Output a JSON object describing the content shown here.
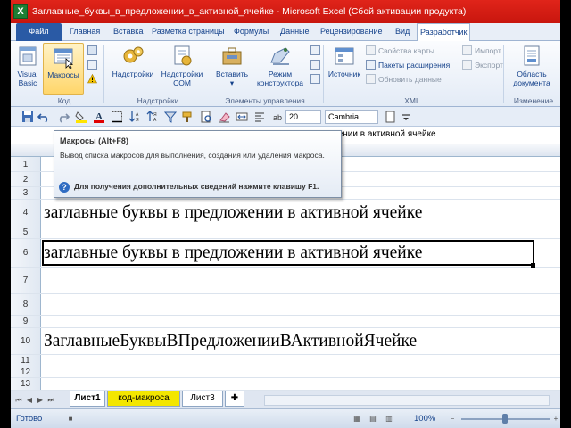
{
  "window": {
    "title": "Заглавные_буквы_в_предложении_в_активной_ячейке - Microsoft Excel (Сбой активации продукта)",
    "app_icon_letter": "X"
  },
  "tabs": [
    {
      "label": "Файл"
    },
    {
      "label": "Главная"
    },
    {
      "label": "Вставка"
    },
    {
      "label": "Разметка страницы"
    },
    {
      "label": "Формулы"
    },
    {
      "label": "Данные"
    },
    {
      "label": "Рецензирование"
    },
    {
      "label": "Вид"
    },
    {
      "label": "Разработчик"
    }
  ],
  "ribbon": {
    "code_group": {
      "label": "Код",
      "visual_basic_line1": "Visual",
      "visual_basic_line2": "Basic",
      "macros": "Макросы"
    },
    "addins_group": {
      "label": "Надстройки",
      "addins": "Надстройки",
      "com_addins_line1": "Надстройки",
      "com_addins_line2": "COM"
    },
    "controls_group": {
      "label": "Элементы управления",
      "insert": "Вставить",
      "design_mode_line1": "Режим",
      "design_mode_line2": "конструктора"
    },
    "xml_group": {
      "label": "XML",
      "source": "Источник",
      "map_properties": "Свойства карты",
      "expansion_packs": "Пакеты расширения",
      "refresh_data": "Обновить данные",
      "import": "Импорт",
      "export": "Экспорт"
    },
    "modify_group": {
      "label": "Изменение",
      "document_panel_line1": "Область",
      "document_panel_line2": "документа"
    }
  },
  "format_bar": {
    "font_size": "20",
    "font_name": "Cambria"
  },
  "formula_bar": {
    "content_visible": "жении в активной ячейке"
  },
  "rows": [
    {
      "num": "1",
      "text": ""
    },
    {
      "num": "2",
      "text": ""
    },
    {
      "num": "3",
      "text": ""
    },
    {
      "num": "4",
      "text": "заглавные буквы в предложении в активной ячейке"
    },
    {
      "num": "5",
      "text": ""
    },
    {
      "num": "6",
      "text": "заглавные буквы в предложении в активной ячейке"
    },
    {
      "num": "7",
      "text": ""
    },
    {
      "num": "8",
      "text": ""
    },
    {
      "num": "9",
      "text": ""
    },
    {
      "num": "10",
      "text": "ЗаглавныеБуквыВПредложенииВАктивнойЯчейке"
    },
    {
      "num": "11",
      "text": ""
    },
    {
      "num": "12",
      "text": ""
    },
    {
      "num": "13",
      "text": ""
    }
  ],
  "tooltip": {
    "title": "Макросы (Alt+F8)",
    "body": "Вывод списка макросов для выполнения, создания или удаления макроса.",
    "help": "Для получения дополнительных сведений нажмите клавишу F1."
  },
  "sheets": [
    {
      "label": "Лист1"
    },
    {
      "label": "код-макроса"
    },
    {
      "label": "Лист3"
    }
  ],
  "status": {
    "ready": "Готово",
    "zoom": "100%"
  }
}
